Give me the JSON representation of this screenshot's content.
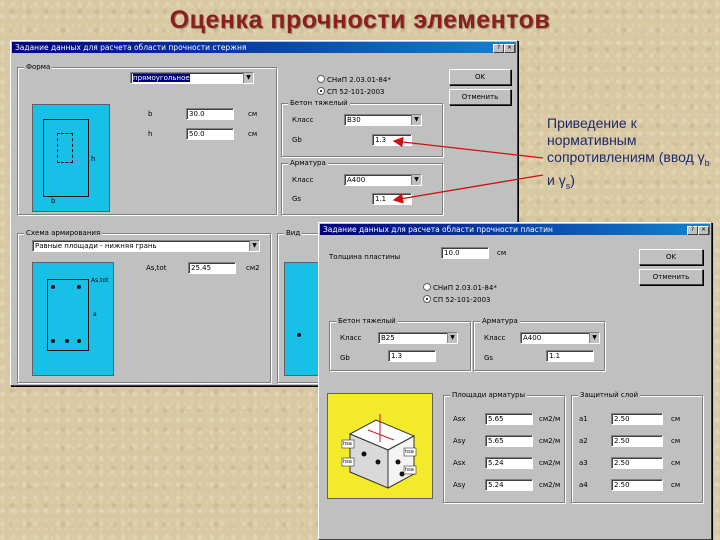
{
  "slide": {
    "title": "Оценка прочности элементов",
    "annotation_main": "Приведение к нормативным сопротивлениям (ввод γ",
    "annotation_sub_b": "b",
    "annotation_mid": " и γ",
    "annotation_sub_s": "s",
    "annotation_end": ")",
    "arrow_color": "#cc1111"
  },
  "rod_dialog": {
    "title": "Задание данных для расчета области прочности стержня",
    "shape_group": "Форма",
    "shape_value": "прямоугольное",
    "label_b_dim": "b",
    "label_h_dim": "h",
    "label_b": "b",
    "label_h": "h",
    "b_value": "30.0",
    "h_value": "50.0",
    "unit_cm": "см",
    "norm_option_1": "СНиП 2.03.01-84*",
    "norm_option_2": "СП 52-101-2003",
    "concrete_group": "Бетон тяжелый",
    "concrete_class_label": "Класс",
    "concrete_class_value": "B30",
    "gamma_b_label": "Gb",
    "gamma_b_value": "1.3",
    "rebar_group": "Арматура",
    "rebar_class_label": "Класс",
    "rebar_class_value": "A400",
    "gamma_s_label": "Gs",
    "gamma_s_value": "1.1",
    "ok_label": "OK",
    "cancel_label": "Отменить",
    "layout_group": "Схема армирования",
    "layout_value": "Равные площади - нижняя грань",
    "astot_label": "As,tot",
    "astot_value": "25.45",
    "unit_cm2": "см2",
    "side_group": "Вид",
    "pic_label_astot": "As,tot",
    "pic_label_a": "a"
  },
  "plate_dialog": {
    "title": "Задание данных для расчета области прочности пластин",
    "thickness_label": "Толщина пластины",
    "thickness_value": "10.0",
    "unit_cm": "см",
    "ok_label": "OK",
    "cancel_label": "Отменить",
    "norm_option_1": "СНиП 2.03.01-84*",
    "norm_option_2": "СП 52-101-2003",
    "concrete_group": "Бетон тяжелый",
    "concrete_class_label": "Класс",
    "concrete_class_value": "B25",
    "gamma_b_label": "Gb",
    "gamma_b_value": "1.3",
    "rebar_group": "Арматура",
    "rebar_class_label": "Класс",
    "rebar_class_value": "A400",
    "gamma_s_label": "Gs",
    "gamma_s_value": "1.1",
    "area_group": "Площади арматуры",
    "cover_group": "Защитный слой",
    "rows": [
      {
        "label": "Asx",
        "value": "5.65",
        "unit": "см2/м",
        "cover_label": "a1",
        "cover_value": "2.50",
        "cover_unit": "см"
      },
      {
        "label": "Asy",
        "value": "5.65",
        "unit": "см2/м",
        "cover_label": "a2",
        "cover_value": "2.50",
        "cover_unit": "см"
      },
      {
        "label": "Asx",
        "value": "5.24",
        "unit": "см2/м",
        "cover_label": "a3",
        "cover_value": "2.50",
        "cover_unit": "см"
      },
      {
        "label": "Asy",
        "value": "5.24",
        "unit": "см2/м",
        "cover_label": "a4",
        "cover_value": "2.50",
        "cover_unit": "см"
      }
    ],
    "pic_labels": [
      "hsa",
      "hsa",
      "hsa",
      "hsa"
    ]
  }
}
